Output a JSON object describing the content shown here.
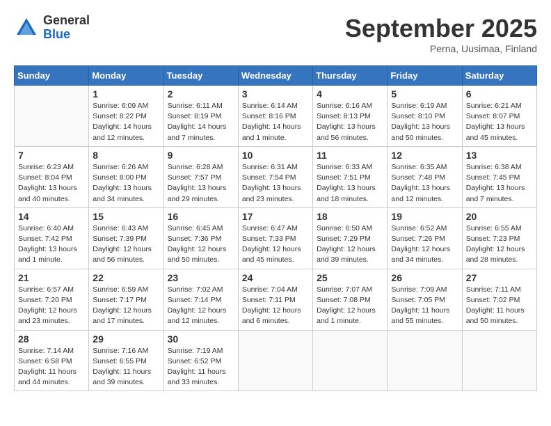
{
  "logo": {
    "general": "General",
    "blue": "Blue"
  },
  "title": "September 2025",
  "subtitle": "Perna, Uusimaa, Finland",
  "days_of_week": [
    "Sunday",
    "Monday",
    "Tuesday",
    "Wednesday",
    "Thursday",
    "Friday",
    "Saturday"
  ],
  "weeks": [
    [
      {
        "num": "",
        "info": ""
      },
      {
        "num": "1",
        "info": "Sunrise: 6:09 AM\nSunset: 8:22 PM\nDaylight: 14 hours\nand 12 minutes."
      },
      {
        "num": "2",
        "info": "Sunrise: 6:11 AM\nSunset: 8:19 PM\nDaylight: 14 hours\nand 7 minutes."
      },
      {
        "num": "3",
        "info": "Sunrise: 6:14 AM\nSunset: 8:16 PM\nDaylight: 14 hours\nand 1 minute."
      },
      {
        "num": "4",
        "info": "Sunrise: 6:16 AM\nSunset: 8:13 PM\nDaylight: 13 hours\nand 56 minutes."
      },
      {
        "num": "5",
        "info": "Sunrise: 6:19 AM\nSunset: 8:10 PM\nDaylight: 13 hours\nand 50 minutes."
      },
      {
        "num": "6",
        "info": "Sunrise: 6:21 AM\nSunset: 8:07 PM\nDaylight: 13 hours\nand 45 minutes."
      }
    ],
    [
      {
        "num": "7",
        "info": "Sunrise: 6:23 AM\nSunset: 8:04 PM\nDaylight: 13 hours\nand 40 minutes."
      },
      {
        "num": "8",
        "info": "Sunrise: 6:26 AM\nSunset: 8:00 PM\nDaylight: 13 hours\nand 34 minutes."
      },
      {
        "num": "9",
        "info": "Sunrise: 6:28 AM\nSunset: 7:57 PM\nDaylight: 13 hours\nand 29 minutes."
      },
      {
        "num": "10",
        "info": "Sunrise: 6:31 AM\nSunset: 7:54 PM\nDaylight: 13 hours\nand 23 minutes."
      },
      {
        "num": "11",
        "info": "Sunrise: 6:33 AM\nSunset: 7:51 PM\nDaylight: 13 hours\nand 18 minutes."
      },
      {
        "num": "12",
        "info": "Sunrise: 6:35 AM\nSunset: 7:48 PM\nDaylight: 13 hours\nand 12 minutes."
      },
      {
        "num": "13",
        "info": "Sunrise: 6:38 AM\nSunset: 7:45 PM\nDaylight: 13 hours\nand 7 minutes."
      }
    ],
    [
      {
        "num": "14",
        "info": "Sunrise: 6:40 AM\nSunset: 7:42 PM\nDaylight: 13 hours\nand 1 minute."
      },
      {
        "num": "15",
        "info": "Sunrise: 6:43 AM\nSunset: 7:39 PM\nDaylight: 12 hours\nand 56 minutes."
      },
      {
        "num": "16",
        "info": "Sunrise: 6:45 AM\nSunset: 7:36 PM\nDaylight: 12 hours\nand 50 minutes."
      },
      {
        "num": "17",
        "info": "Sunrise: 6:47 AM\nSunset: 7:33 PM\nDaylight: 12 hours\nand 45 minutes."
      },
      {
        "num": "18",
        "info": "Sunrise: 6:50 AM\nSunset: 7:29 PM\nDaylight: 12 hours\nand 39 minutes."
      },
      {
        "num": "19",
        "info": "Sunrise: 6:52 AM\nSunset: 7:26 PM\nDaylight: 12 hours\nand 34 minutes."
      },
      {
        "num": "20",
        "info": "Sunrise: 6:55 AM\nSunset: 7:23 PM\nDaylight: 12 hours\nand 28 minutes."
      }
    ],
    [
      {
        "num": "21",
        "info": "Sunrise: 6:57 AM\nSunset: 7:20 PM\nDaylight: 12 hours\nand 23 minutes."
      },
      {
        "num": "22",
        "info": "Sunrise: 6:59 AM\nSunset: 7:17 PM\nDaylight: 12 hours\nand 17 minutes."
      },
      {
        "num": "23",
        "info": "Sunrise: 7:02 AM\nSunset: 7:14 PM\nDaylight: 12 hours\nand 12 minutes."
      },
      {
        "num": "24",
        "info": "Sunrise: 7:04 AM\nSunset: 7:11 PM\nDaylight: 12 hours\nand 6 minutes."
      },
      {
        "num": "25",
        "info": "Sunrise: 7:07 AM\nSunset: 7:08 PM\nDaylight: 12 hours\nand 1 minute."
      },
      {
        "num": "26",
        "info": "Sunrise: 7:09 AM\nSunset: 7:05 PM\nDaylight: 11 hours\nand 55 minutes."
      },
      {
        "num": "27",
        "info": "Sunrise: 7:11 AM\nSunset: 7:02 PM\nDaylight: 11 hours\nand 50 minutes."
      }
    ],
    [
      {
        "num": "28",
        "info": "Sunrise: 7:14 AM\nSunset: 6:58 PM\nDaylight: 11 hours\nand 44 minutes."
      },
      {
        "num": "29",
        "info": "Sunrise: 7:16 AM\nSunset: 6:55 PM\nDaylight: 11 hours\nand 39 minutes."
      },
      {
        "num": "30",
        "info": "Sunrise: 7:19 AM\nSunset: 6:52 PM\nDaylight: 11 hours\nand 33 minutes."
      },
      {
        "num": "",
        "info": ""
      },
      {
        "num": "",
        "info": ""
      },
      {
        "num": "",
        "info": ""
      },
      {
        "num": "",
        "info": ""
      }
    ]
  ]
}
